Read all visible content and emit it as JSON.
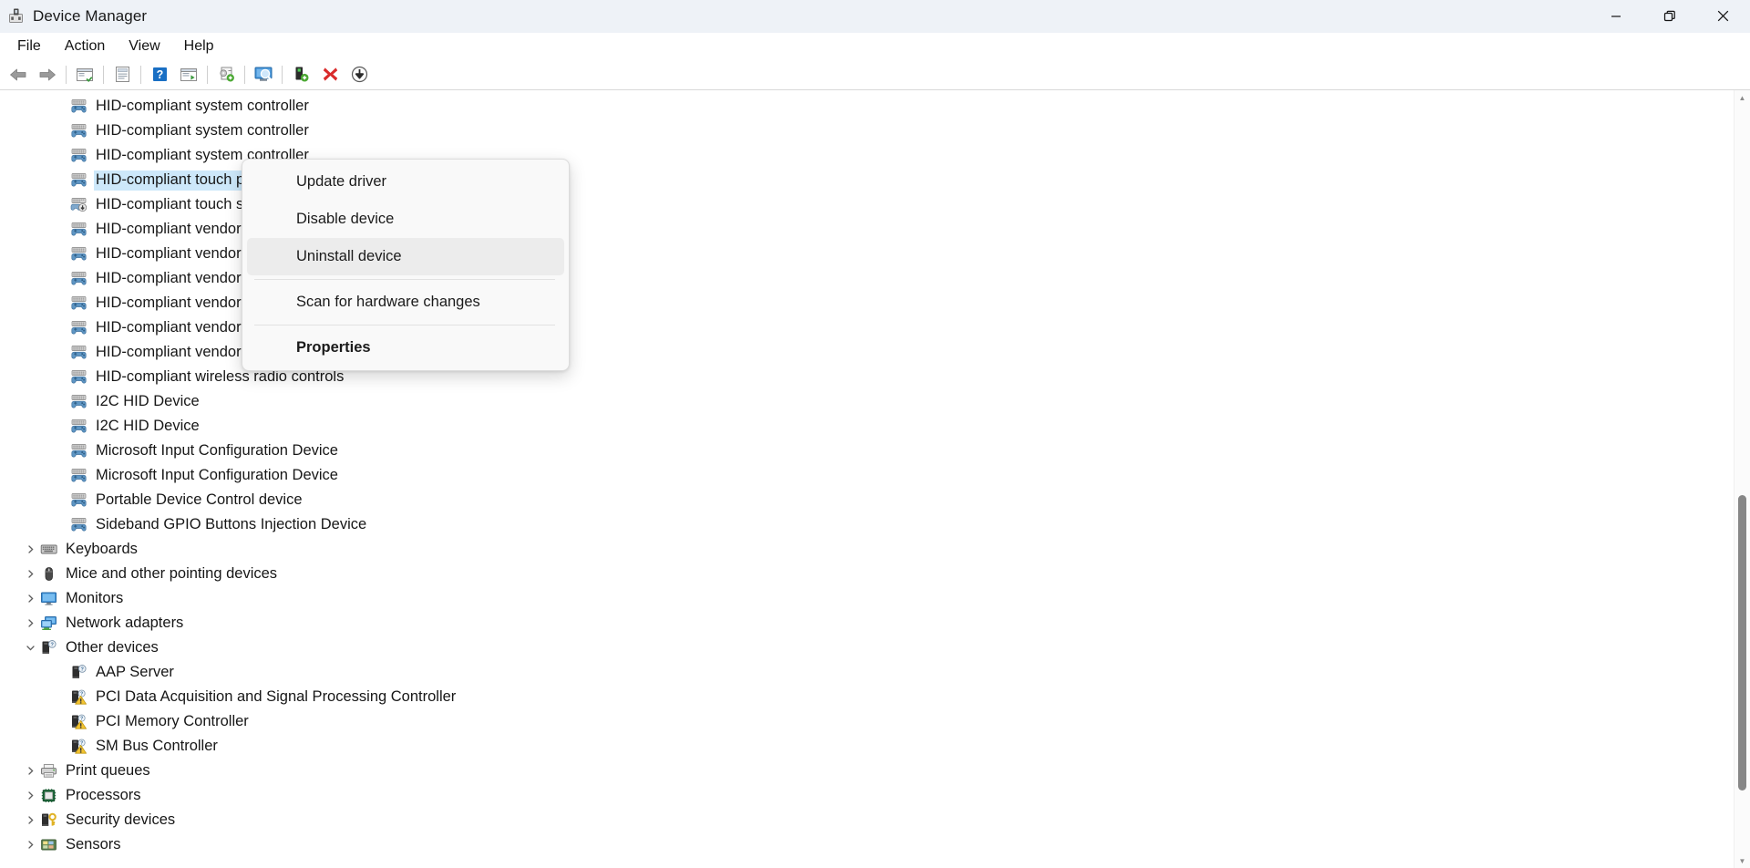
{
  "window": {
    "title": "Device Manager",
    "app_icon": "device-manager-icon",
    "controls": {
      "minimize": "minimize-icon",
      "restore": "restore-icon",
      "close": "close-icon"
    }
  },
  "menubar": {
    "items": [
      {
        "label": "File"
      },
      {
        "label": "Action"
      },
      {
        "label": "View"
      },
      {
        "label": "Help"
      }
    ]
  },
  "toolbar": {
    "buttons": [
      {
        "name": "back-button",
        "icon": "back-arrow-icon"
      },
      {
        "name": "forward-button",
        "icon": "forward-arrow-icon"
      },
      {
        "name": "show-hide-console-tree-button",
        "icon": "console-tree-icon"
      },
      {
        "name": "properties-button",
        "icon": "properties-page-icon"
      },
      {
        "name": "help-button",
        "icon": "help-question-icon"
      },
      {
        "name": "show-hide-action-pane-button",
        "icon": "action-pane-icon"
      },
      {
        "name": "update-driver-software-button",
        "icon": "update-driver-icon"
      },
      {
        "name": "scan-for-hardware-changes-button",
        "icon": "scan-hardware-icon"
      },
      {
        "name": "enable-device-button",
        "icon": "enable-device-icon"
      },
      {
        "name": "uninstall-device-button",
        "icon": "red-x-icon"
      },
      {
        "name": "download-driver-button",
        "icon": "circle-down-arrow-icon"
      }
    ]
  },
  "tree": {
    "rows": [
      {
        "label": "HID-compliant system controller",
        "icon": "hid-device-icon",
        "level": 2,
        "expandable": false,
        "selected": false
      },
      {
        "label": "HID-compliant system controller",
        "icon": "hid-device-icon",
        "level": 2,
        "expandable": false,
        "selected": false
      },
      {
        "label": "HID-compliant system controller",
        "icon": "hid-device-icon",
        "level": 2,
        "expandable": false,
        "selected": false
      },
      {
        "label": "HID-compliant touch pad",
        "icon": "hid-device-icon",
        "level": 2,
        "expandable": false,
        "selected": true
      },
      {
        "label": "HID-compliant touch screen",
        "icon": "touch-screen-icon",
        "level": 2,
        "expandable": false,
        "selected": false
      },
      {
        "label": "HID-compliant vendor-defined device",
        "icon": "hid-device-icon",
        "level": 2,
        "expandable": false,
        "selected": false
      },
      {
        "label": "HID-compliant vendor-defined device",
        "icon": "hid-device-icon",
        "level": 2,
        "expandable": false,
        "selected": false
      },
      {
        "label": "HID-compliant vendor-defined device",
        "icon": "hid-device-icon",
        "level": 2,
        "expandable": false,
        "selected": false
      },
      {
        "label": "HID-compliant vendor-defined device",
        "icon": "hid-device-icon",
        "level": 2,
        "expandable": false,
        "selected": false
      },
      {
        "label": "HID-compliant vendor-defined device",
        "icon": "hid-device-icon",
        "level": 2,
        "expandable": false,
        "selected": false
      },
      {
        "label": "HID-compliant vendor-defined device",
        "icon": "hid-device-icon",
        "level": 2,
        "expandable": false,
        "selected": false
      },
      {
        "label": "HID-compliant wireless radio controls",
        "icon": "hid-device-icon",
        "level": 2,
        "expandable": false,
        "selected": false
      },
      {
        "label": "I2C HID Device",
        "icon": "hid-device-icon",
        "level": 2,
        "expandable": false,
        "selected": false
      },
      {
        "label": "I2C HID Device",
        "icon": "hid-device-icon",
        "level": 2,
        "expandable": false,
        "selected": false
      },
      {
        "label": "Microsoft Input Configuration Device",
        "icon": "hid-device-icon",
        "level": 2,
        "expandable": false,
        "selected": false
      },
      {
        "label": "Microsoft Input Configuration Device",
        "icon": "hid-device-icon",
        "level": 2,
        "expandable": false,
        "selected": false
      },
      {
        "label": "Portable Device Control device",
        "icon": "hid-device-icon",
        "level": 2,
        "expandable": false,
        "selected": false
      },
      {
        "label": "Sideband GPIO Buttons Injection Device",
        "icon": "hid-device-icon",
        "level": 2,
        "expandable": false,
        "selected": false
      },
      {
        "label": "Keyboards",
        "icon": "keyboard-icon",
        "level": 1,
        "expandable": true,
        "expanded": false,
        "selected": false
      },
      {
        "label": "Mice and other pointing devices",
        "icon": "mouse-icon",
        "level": 1,
        "expandable": true,
        "expanded": false,
        "selected": false
      },
      {
        "label": "Monitors",
        "icon": "monitor-icon",
        "level": 1,
        "expandable": true,
        "expanded": false,
        "selected": false
      },
      {
        "label": "Network adapters",
        "icon": "network-adapter-icon",
        "level": 1,
        "expandable": true,
        "expanded": false,
        "selected": false
      },
      {
        "label": "Other devices",
        "icon": "unknown-device-icon",
        "level": 1,
        "expandable": true,
        "expanded": true,
        "selected": false
      },
      {
        "label": "AAP Server",
        "icon": "unknown-device-icon",
        "level": 2,
        "expandable": false,
        "selected": false
      },
      {
        "label": "PCI Data Acquisition and Signal Processing Controller",
        "icon": "warning-device-icon",
        "level": 2,
        "expandable": false,
        "selected": false
      },
      {
        "label": "PCI Memory Controller",
        "icon": "warning-device-icon",
        "level": 2,
        "expandable": false,
        "selected": false
      },
      {
        "label": "SM Bus Controller",
        "icon": "warning-device-icon",
        "level": 2,
        "expandable": false,
        "selected": false
      },
      {
        "label": "Print queues",
        "icon": "printer-icon",
        "level": 1,
        "expandable": true,
        "expanded": false,
        "selected": false
      },
      {
        "label": "Processors",
        "icon": "processor-icon",
        "level": 1,
        "expandable": true,
        "expanded": false,
        "selected": false
      },
      {
        "label": "Security devices",
        "icon": "security-key-icon",
        "level": 1,
        "expandable": true,
        "expanded": false,
        "selected": false
      },
      {
        "label": "Sensors",
        "icon": "sensor-icon",
        "level": 1,
        "expandable": true,
        "expanded": false,
        "selected": false
      }
    ]
  },
  "context_menu": {
    "items": [
      {
        "label": "Update driver",
        "highlighted": false,
        "bold": false,
        "separator_after": false
      },
      {
        "label": "Disable device",
        "highlighted": false,
        "bold": false,
        "separator_after": false
      },
      {
        "label": "Uninstall device",
        "highlighted": true,
        "bold": false,
        "separator_after": true
      },
      {
        "label": "Scan for hardware changes",
        "highlighted": false,
        "bold": false,
        "separator_after": true
      },
      {
        "label": "Properties",
        "highlighted": false,
        "bold": true,
        "separator_after": false
      }
    ]
  },
  "colors": {
    "titlebar_bg": "#eef2f7",
    "selection_bg": "#cde8fa",
    "menu_highlight": "#ececec",
    "warning_yellow": "#f2c230",
    "accent_blue": "#3c8fd4",
    "close_red": "#e81123"
  },
  "scrollbar": {
    "thumb_top_pct": 52,
    "thumb_height_pct": 38
  }
}
